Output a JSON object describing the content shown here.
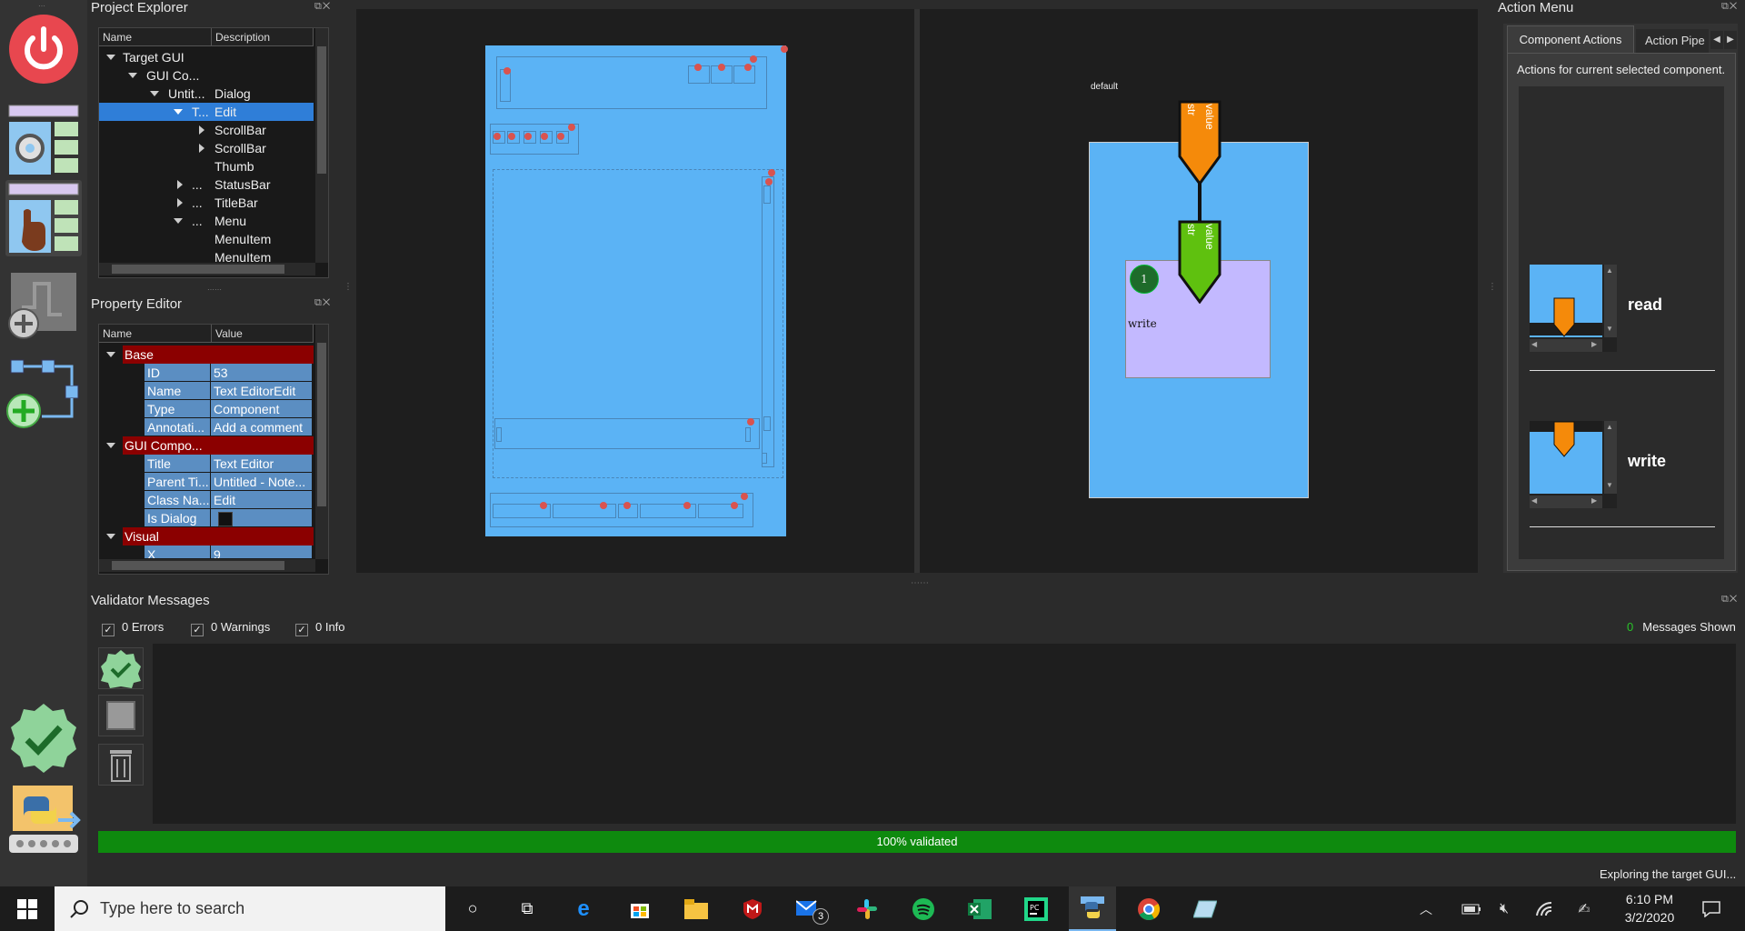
{
  "project_explorer": {
    "title": "Project Explorer",
    "columns": [
      "Name",
      "Description"
    ],
    "rows": [
      {
        "name": "Target GUI",
        "desc": ""
      },
      {
        "name": "GUI Co...",
        "desc": ""
      },
      {
        "name": "Untit...",
        "desc": "Dialog"
      },
      {
        "name": "T...",
        "desc": "Edit"
      },
      {
        "name": "",
        "desc": "ScrollBar"
      },
      {
        "name": "",
        "desc": "ScrollBar"
      },
      {
        "name": "",
        "desc": "Thumb"
      },
      {
        "name": "...",
        "desc": "StatusBar"
      },
      {
        "name": "...",
        "desc": "TitleBar"
      },
      {
        "name": "...",
        "desc": "Menu"
      },
      {
        "name": "",
        "desc": "MenuItem"
      },
      {
        "name": "",
        "desc": "MenuItem"
      }
    ]
  },
  "property_editor": {
    "title": "Property Editor",
    "columns": [
      "Name",
      "Value"
    ],
    "sections": [
      {
        "label": "Base",
        "rows": [
          {
            "name": "ID",
            "value": "53"
          },
          {
            "name": "Name",
            "value": "Text EditorEdit"
          },
          {
            "name": "Type",
            "value": "Component"
          },
          {
            "name": "Annotati...",
            "value": "Add a comment"
          }
        ]
      },
      {
        "label": "GUI Compo...",
        "rows": [
          {
            "name": "Title",
            "value": "Text Editor"
          },
          {
            "name": "Parent Ti...",
            "value": "Untitled - Note..."
          },
          {
            "name": "Class Na...",
            "value": "Edit"
          },
          {
            "name": "Is Dialog",
            "value": ""
          }
        ]
      },
      {
        "label": "Visual",
        "rows": [
          {
            "name": "X",
            "value": "9"
          }
        ]
      }
    ]
  },
  "canvas": {
    "state_label": "default",
    "port_label_value": "value",
    "port_label_type": "str",
    "action_number": "1",
    "action_label": "write"
  },
  "action_menu": {
    "title": "Action Menu",
    "tabs": [
      "Component Actions",
      "Action Pipe"
    ],
    "description": "Actions for current selected component.",
    "actions": [
      {
        "label": "read"
      },
      {
        "label": "write"
      }
    ]
  },
  "validator": {
    "title": "Validator Messages",
    "filters": [
      "0 Errors",
      "0 Warnings",
      "0 Info"
    ],
    "messages_count": "0",
    "messages_label": "Messages Shown",
    "progress_text": "100% validated",
    "progress": 1.0
  },
  "status_text": "Exploring the target GUI...",
  "taskbar": {
    "search_placeholder": "Type here to search",
    "mail_badge": "3",
    "time": "6:10 PM",
    "date": "3/2/2020"
  },
  "colors": {
    "accent_blue": "#5bb3f5",
    "port_orange": "#f58a0a",
    "port_green": "#5fc10f",
    "action_purple": "#c3b9ff",
    "section_red": "#8b0000",
    "progress_green": "#0e8a0e"
  }
}
